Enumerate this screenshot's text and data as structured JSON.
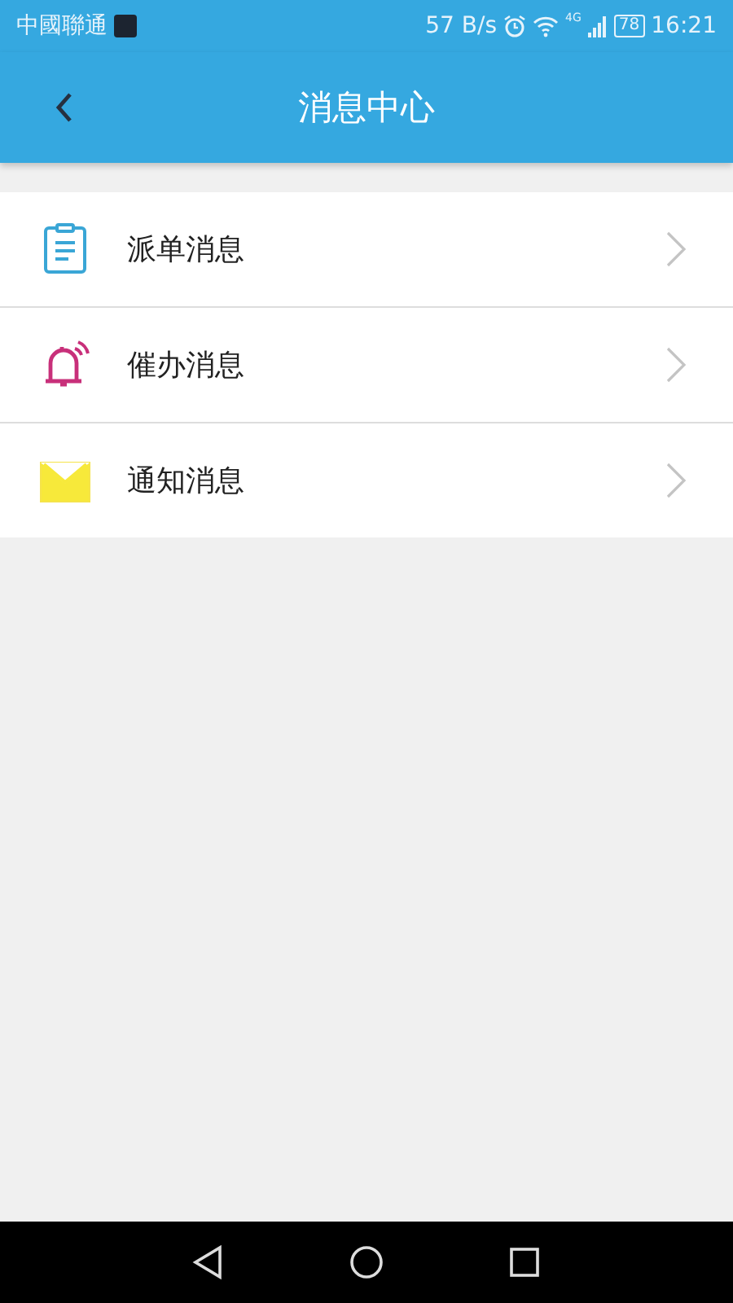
{
  "status_bar": {
    "carrier": "中國聯通",
    "speed": "57 B/s",
    "network": "4G",
    "battery": "78",
    "time": "16:21"
  },
  "header": {
    "title": "消息中心"
  },
  "items": [
    {
      "kind": "clipboard",
      "label": "派单消息"
    },
    {
      "kind": "bell",
      "label": "催办消息"
    },
    {
      "kind": "envelope",
      "label": "通知消息"
    }
  ]
}
